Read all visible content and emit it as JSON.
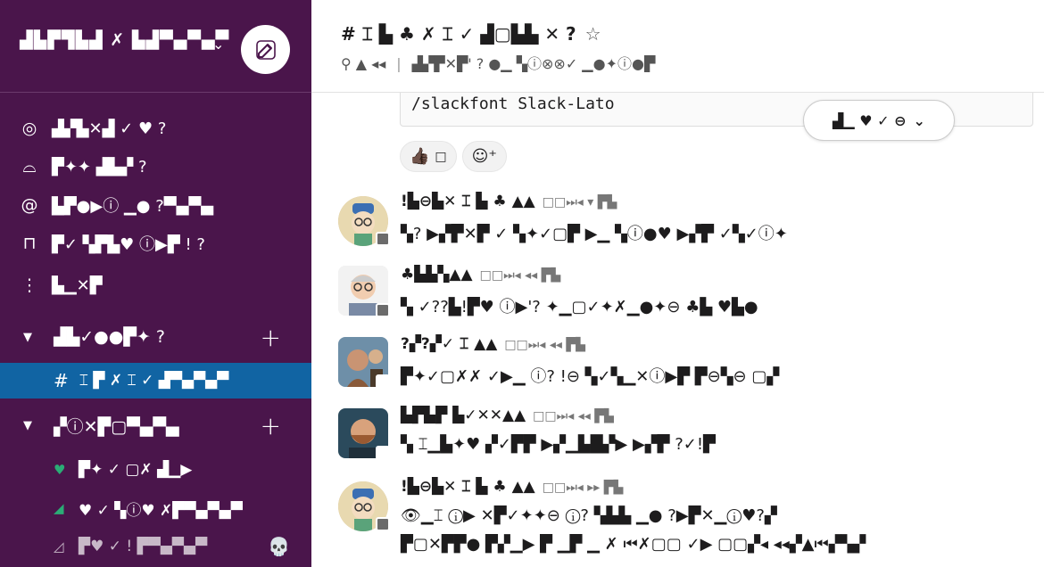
{
  "workspace": {
    "name": "▟▙▛▜▙▟ ✗ ▙▟▀▄▀▄▀",
    "chevron": "⌄"
  },
  "nav": [
    {
      "icon": "◎",
      "label": "▟▞▙✕▟ ✓ ♥ ?"
    },
    {
      "icon": "⌓",
      "label": "▛✦✦ ▟▙▞ ?"
    },
    {
      "icon": "@",
      "label": "▙▛●▶ⓘ ▁● ?▀▄▀▄"
    },
    {
      "icon": "⊓",
      "label": "▛✓ ▚▛▙♥ ⓘ▶▛ ! ?"
    },
    {
      "icon": "⋮",
      "label": "▙▁✕▛"
    }
  ],
  "sections": [
    {
      "caret": "▼",
      "label": "▟▙✓●●▛✦ ?",
      "plus": "+"
    },
    {
      "caret": "▼",
      "label": "▞ⓘ✕▛▢▀▄▀▄",
      "plus": "+"
    }
  ],
  "active_channel": {
    "hash": "#",
    "label": "⌶ ▛ ✗ ⌶ ✓ ▟▀▄▀▄▀"
  },
  "dms": [
    {
      "status": "♥",
      "status_color": "#2bac76",
      "label": "▛✦ ✓ ▢✗ ▟▁▶"
    },
    {
      "status": "◢",
      "status_color": "#2bac76",
      "label": "♥ ✓ ▚ⓘ♥ ✗▛▀▄▀▄▀"
    },
    {
      "status": "◿",
      "status_color": "#c8b8c8",
      "label": "▛♥ ✓ ! ▛▀▄▀▄▀",
      "skull": "💀"
    }
  ],
  "channel": {
    "title": "# ⌶ ▙ ♣ ✗ ⌶ ✓ ▟▢▙▙ ✕ ?",
    "star": "☆",
    "pin": "⚲ ▲ ◂◂",
    "meta": "▟▞▛✕▛' ? ●▁ ▚ⓘ⊗⊗✓ ▁●✦ⓘ●▛"
  },
  "code_line": "/slackfont Slack-Lato",
  "dropdown": {
    "label": "▟▁ ♥ ✓ ⊖",
    "chevron": "⌄"
  },
  "reactions": [
    {
      "emoji": "👍🏿",
      "count": "□"
    },
    {
      "emoji": "☺⁺",
      "count": ""
    }
  ],
  "messages": [
    {
      "name": "!▙⊖▙✕ ⌶ ▙ ♣ ▲▲",
      "time": "□□⏭◂ ▾ ▛▙",
      "text": "▚? ▶▞▛✕▛ ✓ ▚✦✓▢▛ ▶▁ ▚ⓘ●♥ ▶▞▛ ✓▚✓ⓘ✦"
    },
    {
      "name": "♣▙▙▚▲▲",
      "time": "□□⏭◂ ◂◂ ▛▙",
      "text": "▚ ✓??▙!▛♥ ⓘ▶'? ✦▁▢✓✦✗▁●✦⊖ ♣▙ ♥▙●"
    },
    {
      "name": "?▞?▞✓ ⌶ ▲▲",
      "time": "□□⏭◂ ◂◂ ▛▙",
      "text": "▛✦✓▢✗✗ ✓▶▁ ⓘ? !⊖ ▚✓▚▁✕ⓘ▶▛ ▛⊖▚⊖ ▢▞"
    },
    {
      "name": "▙▛▙▛ ▙✓✕✕▲▲",
      "time": "□□⏭◂ ◂◂ ▛▙",
      "text": "▚ ⌶▁▙✦♥ ▞✓▛▛ ▶▞▁▙█▞▶ ▶▞▛ ?✓!▛"
    },
    {
      "name": "!▙⊖▙✕ ⌶ ▙ ♣ ▲▲",
      "time": "□□⏭◂ ▸▸ ▛▙",
      "text": "👁▁⌶ ⓘ▶ ✕▛✓✦✦⊖ ⓘ? ▚▙▙ ▁● ?▶▛✕▁ⓘ♥?▞",
      "text2": "▛▢✕▛▛● ▛▞▁▶ ▛ ▁▛ ▁ ✗ ⏮✗▢▢ ✓▶ ▢▢▞◂ ◂◂▞▲⏮▞▚▞"
    }
  ],
  "colors": {
    "sidebar_bg": "#4a154b",
    "active_bg": "#1164a3",
    "presence_green": "#2bac76"
  }
}
